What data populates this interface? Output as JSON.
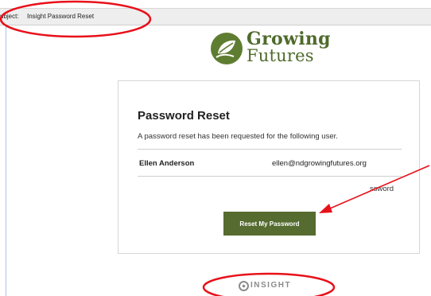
{
  "email": {
    "subject_label": "ubject:",
    "subject_value": "Insight Password Reset"
  },
  "logo": {
    "line1": "Growing",
    "line2": "Futures",
    "icon": "leaf-icon"
  },
  "card": {
    "title": "Password Reset",
    "description": "A password reset has been requested for the following user.",
    "user_name": "Ellen Anderson",
    "user_email": "ellen@ndgrowingfutures.org",
    "clipped_text": "ssword",
    "button_label": "Reset My Password"
  },
  "footer": {
    "brand": "INSIGHT",
    "icon": "insight-logo-icon"
  },
  "colors": {
    "brand_green": "#556b2f",
    "annotation_red": "#e8101a"
  }
}
